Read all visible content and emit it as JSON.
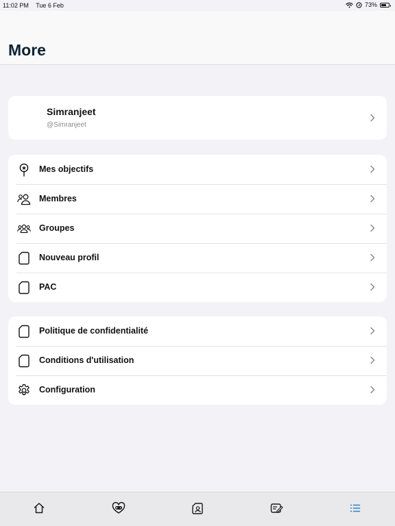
{
  "status_bar": {
    "time": "11:02 PM",
    "date": "Tue 6 Feb",
    "battery": "73%",
    "battery_level": 0.73,
    "icons": [
      "wifi-icon",
      "location-icon",
      "battery-icon"
    ]
  },
  "header": {
    "title": "More"
  },
  "profile": {
    "name": "Simranjeet",
    "handle": "@Simranjeet"
  },
  "group1": {
    "items": [
      {
        "label": "Mes objectifs",
        "icon": "goal-pin-icon"
      },
      {
        "label": "Membres",
        "icon": "members-icon"
      },
      {
        "label": "Groupes",
        "icon": "groups-icon"
      },
      {
        "label": "Nouveau profil",
        "icon": "document-icon"
      },
      {
        "label": "PAC",
        "icon": "document-icon"
      }
    ]
  },
  "group2": {
    "items": [
      {
        "label": "Politique de confidentialité",
        "icon": "document-icon"
      },
      {
        "label": "Conditions d'utilisation",
        "icon": "document-icon"
      },
      {
        "label": "Configuration",
        "icon": "gear-icon"
      }
    ]
  },
  "tab_bar": {
    "tabs": [
      {
        "icon": "home-icon",
        "active": false
      },
      {
        "icon": "heart-gamepad-icon",
        "active": false
      },
      {
        "icon": "profile-card-icon",
        "active": false
      },
      {
        "icon": "edit-note-icon",
        "active": false
      },
      {
        "icon": "list-icon",
        "active": true
      }
    ],
    "active_color": "#2f80c8",
    "inactive_color": "#1a1a1a"
  },
  "colors": {
    "background": "#f2f2f7",
    "card": "#ffffff",
    "title": "#0d2235",
    "chevron": "#8a8a8e"
  }
}
